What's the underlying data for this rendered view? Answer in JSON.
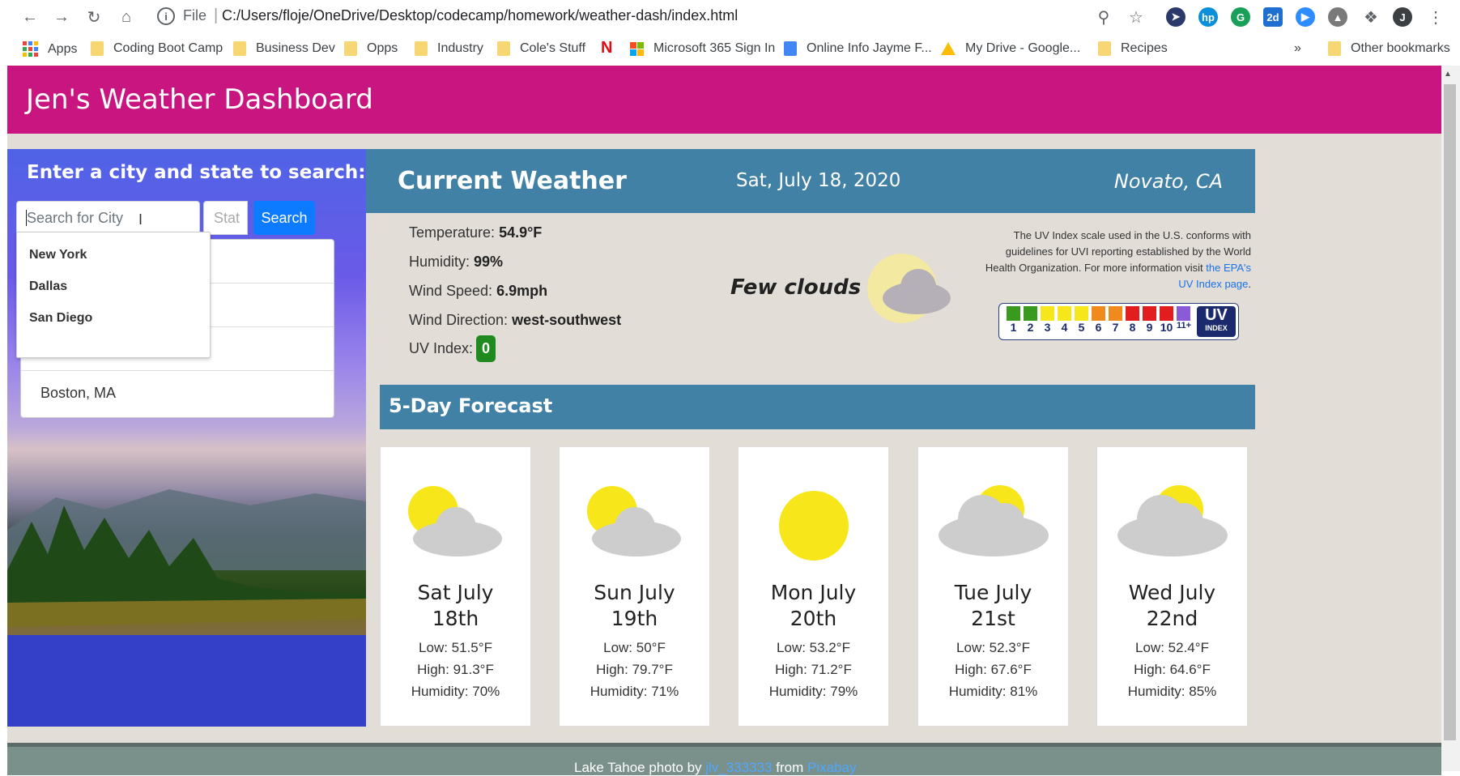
{
  "browser": {
    "file_label": "File",
    "url": "C:/Users/floje/OneDrive/Desktop/codecamp/homework/weather-dash/index.html",
    "profile_initial": "J",
    "bookmarks": [
      "Apps",
      "Coding Boot Camp",
      "Business Dev",
      "Opps",
      "Industry",
      "Cole's Stuff",
      "Microsoft 365 Sign In",
      "Online Info Jayme F...",
      "My Drive - Google...",
      "Recipes"
    ],
    "overflow": "»",
    "other_bookmarks": "Other bookmarks"
  },
  "header": {
    "title": "Jen's Weather Dashboard"
  },
  "search": {
    "prompt": "Enter a city and state to search:",
    "city_placeholder": "Search for City",
    "state_placeholder": "Stat",
    "button_label": "Search",
    "autocomplete": [
      "New York",
      "Dallas",
      "San Diego"
    ],
    "history": [
      "Boston, MA"
    ]
  },
  "current": {
    "title": "Current Weather",
    "date": "Sat, July 18, 2020",
    "location": "Novato, CA",
    "temperature_label": "Temperature:",
    "temperature": "54.9°F",
    "humidity_label": "Humidity:",
    "humidity": "99%",
    "wind_speed_label": "Wind Speed:",
    "wind_speed": "6.9mph",
    "wind_dir_label": "Wind Direction:",
    "wind_dir": "west-southwest",
    "uv_label": "UV Index:",
    "uv": "0",
    "description": "Few clouds",
    "icon": "few-clouds-icon",
    "uv_note": "The UV Index scale used in the U.S. conforms with guidelines for UVI reporting established by the World Health Organization. For more information visit",
    "uv_link": "the EPA's UV Index page",
    "uv_link_suffix": ".",
    "uv_scale_numbers": [
      "1",
      "2",
      "3",
      "4",
      "5",
      "6",
      "7",
      "8",
      "9",
      "10",
      "11+"
    ],
    "uv_scale_colors": [
      "#3a9a1f",
      "#3a9a1f",
      "#f5e71c",
      "#f5e71c",
      "#f5e71c",
      "#f08a1c",
      "#f08a1c",
      "#e21d1d",
      "#e21d1d",
      "#e21d1d",
      "#8a5ad8"
    ],
    "uv_logo": "UV",
    "uv_logo_sub": "INDEX",
    "uv_badge_color": "#1f8a1f"
  },
  "forecast": {
    "title": "5-Day Forecast",
    "days": [
      {
        "day": "Sat July",
        "date": "18th",
        "low": "Low: 51.5°F",
        "high": "High: 91.3°F",
        "humidity": "Humidity: 70%",
        "icon": "sun-behind-cloud-icon"
      },
      {
        "day": "Sun July",
        "date": "19th",
        "low": "Low: 50°F",
        "high": "High: 79.7°F",
        "humidity": "Humidity: 71%",
        "icon": "sun-behind-cloud-icon"
      },
      {
        "day": "Mon July",
        "date": "20th",
        "low": "Low: 53.2°F",
        "high": "High: 71.2°F",
        "humidity": "Humidity: 79%",
        "icon": "sun-icon"
      },
      {
        "day": "Tue July",
        "date": "21st",
        "low": "Low: 52.3°F",
        "high": "High: 67.6°F",
        "humidity": "Humidity: 81%",
        "icon": "cloud-over-sun-icon"
      },
      {
        "day": "Wed July",
        "date": "22nd",
        "low": "Low: 52.4°F",
        "high": "High: 64.6°F",
        "humidity": "Humidity: 85%",
        "icon": "cloud-over-sun-icon"
      }
    ]
  },
  "footer": {
    "prefix": "Lake Tahoe photo by",
    "author": "jlv_333333",
    "middle": "from",
    "source": "Pixabay"
  },
  "colors": {
    "header": "#c8157f",
    "bar": "#4281a6",
    "page": "#e2ddd7",
    "accent": "#0d7bff"
  }
}
